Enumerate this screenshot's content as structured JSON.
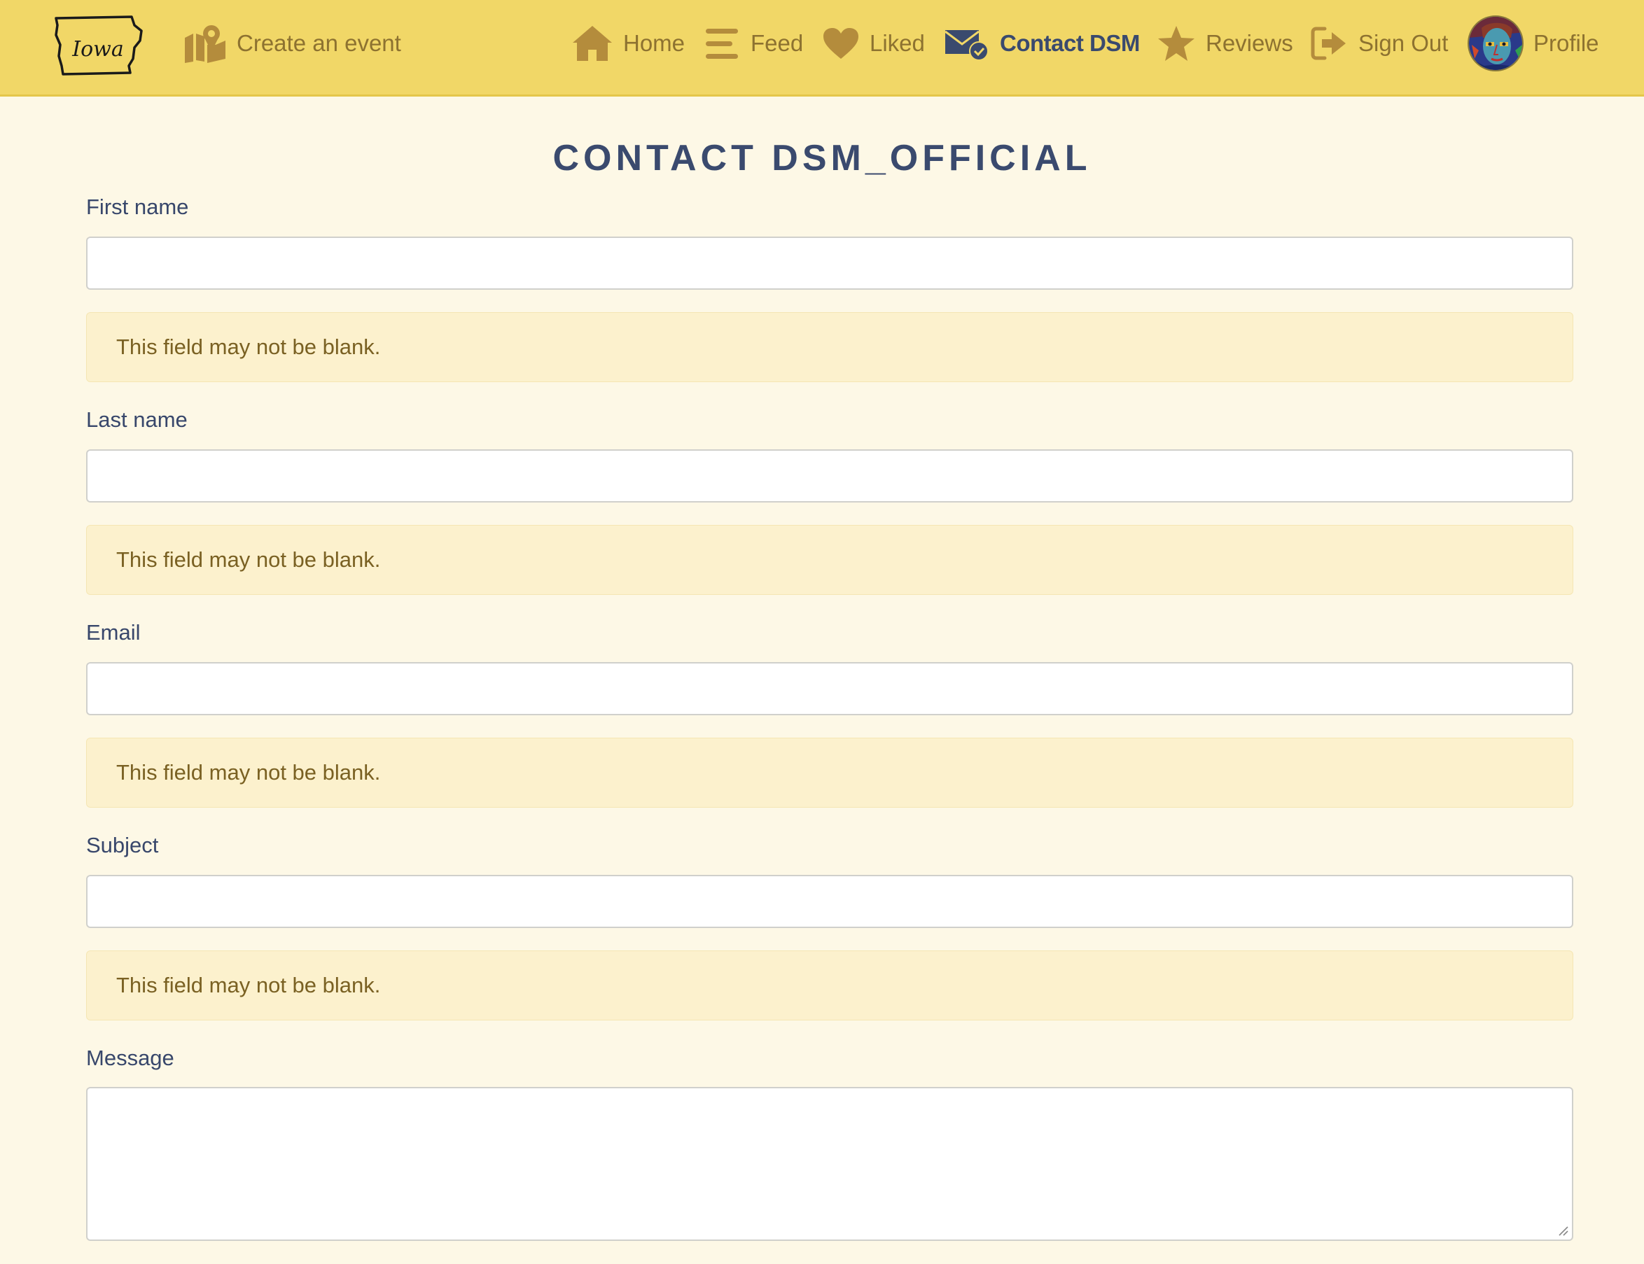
{
  "nav": {
    "logo_text": "Iowa",
    "create_event": "Create an event",
    "home": "Home",
    "feed": "Feed",
    "liked": "Liked",
    "contact": "Contact DSM",
    "reviews": "Reviews",
    "signout": "Sign Out",
    "profile": "Profile"
  },
  "page": {
    "title": "CONTACT DSM_OFFICIAL"
  },
  "form": {
    "first_name": {
      "label": "First name",
      "value": "",
      "error": "This field may not be blank."
    },
    "last_name": {
      "label": "Last name",
      "value": "",
      "error": "This field may not be blank."
    },
    "email": {
      "label": "Email",
      "value": "",
      "error": "This field may not be blank."
    },
    "subject": {
      "label": "Subject",
      "value": "",
      "error": "This field may not be blank."
    },
    "message": {
      "label": "Message",
      "value": ""
    }
  },
  "colors": {
    "navbar": "#f1d767",
    "background": "#fdf8e6",
    "nav_icon": "#b48c3c",
    "active": "#3a4a6e",
    "error_bg": "#fcf1cd",
    "error_text": "#7a6123"
  },
  "icons": {
    "create_event": "map-pin-icon",
    "home": "home-icon",
    "feed": "bars-icon",
    "liked": "heart-icon",
    "contact": "envelope-check-icon",
    "reviews": "star-icon",
    "signout": "sign-out-icon"
  }
}
